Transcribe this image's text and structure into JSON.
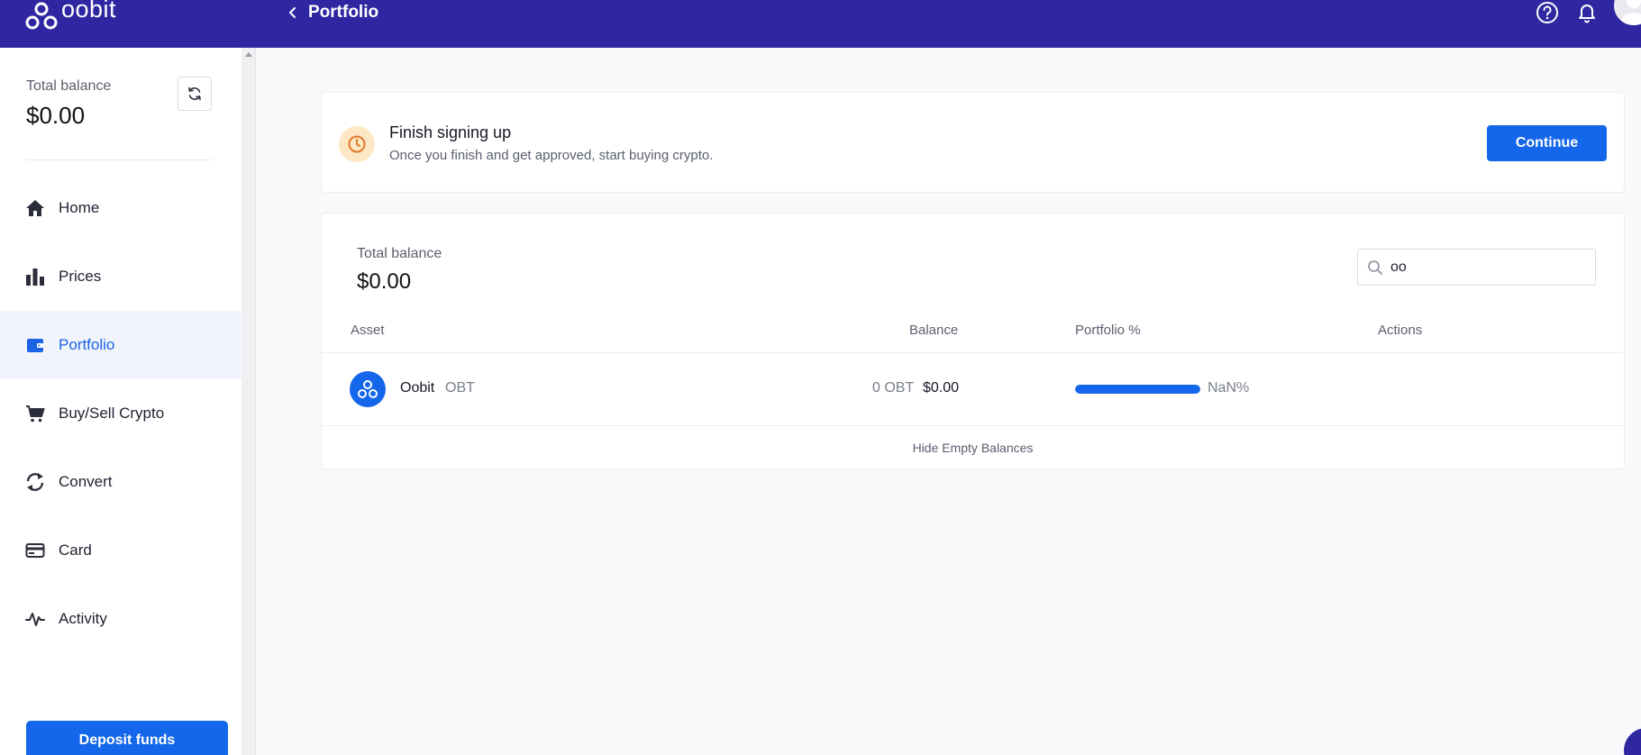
{
  "header": {
    "logo_text": "oobit",
    "page_title": "Portfolio",
    "icons": [
      "help-icon",
      "bell-icon",
      "avatar"
    ]
  },
  "sidebar": {
    "total_balance_label": "Total balance",
    "total_balance_value": "$0.00",
    "items": [
      {
        "label": "Home",
        "icon": "home-icon"
      },
      {
        "label": "Prices",
        "icon": "bar-chart-icon"
      },
      {
        "label": "Portfolio",
        "icon": "wallet-icon",
        "active": true
      },
      {
        "label": "Buy/Sell Crypto",
        "icon": "cart-icon"
      },
      {
        "label": "Convert",
        "icon": "convert-icon"
      },
      {
        "label": "Card",
        "icon": "card-icon"
      },
      {
        "label": "Activity",
        "icon": "activity-icon"
      }
    ],
    "deposit_label": "Deposit funds"
  },
  "signup": {
    "title": "Finish signing up",
    "subtitle": "Once you finish and get approved, start buying crypto.",
    "continue_label": "Continue"
  },
  "portfolio": {
    "total_balance_label": "Total balance",
    "total_balance_value": "$0.00",
    "search_value": "oo",
    "columns": [
      "Asset",
      "Balance",
      "Portfolio %",
      "Actions"
    ],
    "rows": [
      {
        "name": "Oobit",
        "symbol": "OBT",
        "balance_qty": "0 OBT",
        "balance_usd": "$0.00",
        "portfolio_pct_text": "NaN%",
        "bar_fill_fraction": 1.0
      }
    ],
    "hide_empty_label": "Hide Empty Balances"
  },
  "colors": {
    "header_bg": "#2f27a1",
    "primary": "#1467ea",
    "active_nav_bg": "#f1f5fb"
  }
}
